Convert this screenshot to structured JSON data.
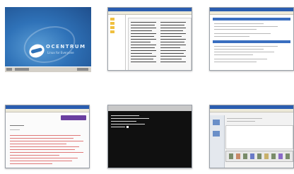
{
  "gallery": {
    "thumbnails": [
      {
        "name": "desktop",
        "brand": "OCENTRUM",
        "tagline": "Linux for Everyone"
      },
      {
        "name": "file-browser"
      },
      {
        "name": "web-form"
      },
      {
        "name": "web-page"
      },
      {
        "name": "terminal"
      },
      {
        "name": "file-manager"
      }
    ]
  },
  "colors": {
    "desktop_blue": "#2f72b8",
    "titlebar_blue": "#2a5db0",
    "accent_purple": "#6a3fa0",
    "terminal_bg": "#101010"
  }
}
